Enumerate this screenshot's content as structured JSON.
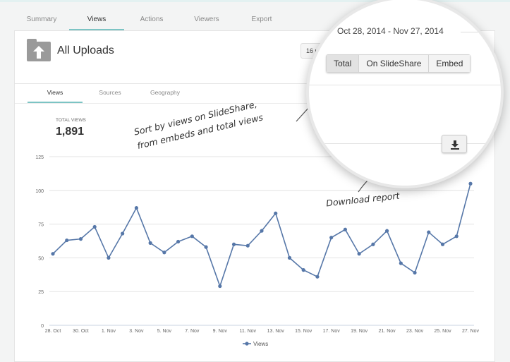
{
  "tabs": [
    "Summary",
    "Views",
    "Actions",
    "Viewers",
    "Export"
  ],
  "active_tab": "Views",
  "header": {
    "title": "All Uploads",
    "uploads_button": "16 u",
    "date_range": "Oct 28, 2014 - Nov 27, 2014"
  },
  "filter": {
    "options": [
      "Total",
      "On SlideShare",
      "Embed"
    ],
    "selected": "Total"
  },
  "subtabs": [
    "Views",
    "Sources",
    "Geography"
  ],
  "total_views": {
    "label": "TOTAL VIEWS",
    "value": "1,891"
  },
  "annotations": {
    "sort": [
      "Sort by views on SlideShare,",
      "from embeds and total views"
    ],
    "download": "Download report"
  },
  "icons": {
    "folder": "folder-upload-icon",
    "download": "download-icon"
  },
  "colors": {
    "accent": "#7cc4c4",
    "series": "#5677a8"
  },
  "chart_data": {
    "type": "line",
    "x": [
      "28. Oct",
      "29. Oct",
      "30. Oct",
      "31. Oct",
      "1. Nov",
      "2. Nov",
      "3. Nov",
      "4. Nov",
      "5. Nov",
      "6. Nov",
      "7. Nov",
      "8. Nov",
      "9. Nov",
      "10. Nov",
      "11. Nov",
      "12. Nov",
      "13. Nov",
      "14. Nov",
      "15. Nov",
      "16. Nov",
      "17. Nov",
      "18. Nov",
      "19. Nov",
      "20. Nov",
      "21. Nov",
      "22. Nov",
      "23. Nov",
      "24. Nov",
      "25. Nov",
      "26. Nov",
      "27. Nov"
    ],
    "x_tick_labels": [
      "28. Oct",
      "30. Oct",
      "1. Nov",
      "3. Nov",
      "5. Nov",
      "7. Nov",
      "9. Nov",
      "11. Nov",
      "13. Nov",
      "15. Nov",
      "17. Nov",
      "19. Nov",
      "21. Nov",
      "23. Nov",
      "25. Nov",
      "27. Nov"
    ],
    "series": [
      {
        "name": "Views",
        "values": [
          53,
          63,
          64,
          73,
          50,
          68,
          87,
          61,
          54,
          62,
          66,
          58,
          29,
          60,
          59,
          70,
          83,
          50,
          41,
          36,
          65,
          71,
          53,
          60,
          70,
          46,
          39,
          69,
          60,
          66,
          105
        ]
      }
    ],
    "y_ticks": [
      0,
      25,
      50,
      75,
      100,
      125
    ],
    "ylim": [
      0,
      125
    ],
    "grid": true,
    "legend": "bottom"
  }
}
